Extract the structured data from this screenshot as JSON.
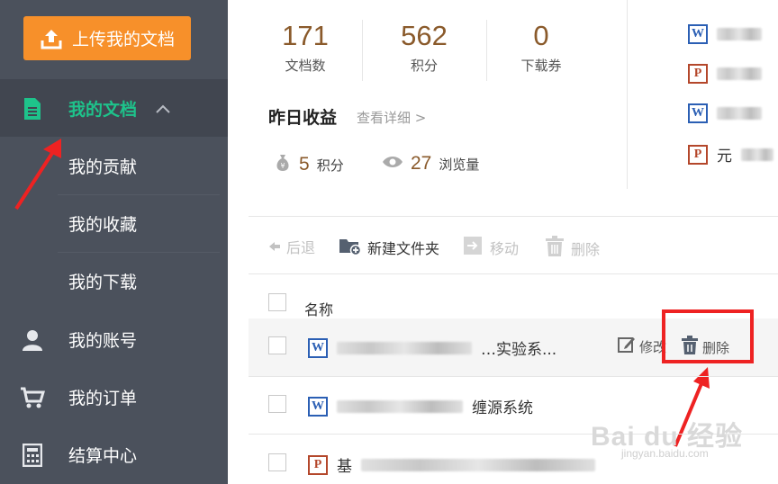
{
  "sidebar": {
    "upload_label": "上传我的文档",
    "items": [
      {
        "label": "我的文档",
        "icon": "document-icon",
        "active": true
      },
      {
        "label": "我的贡献"
      },
      {
        "label": "我的收藏"
      },
      {
        "label": "我的下载"
      },
      {
        "label": "我的账号",
        "icon": "user-icon"
      },
      {
        "label": "我的订单",
        "icon": "cart-icon"
      },
      {
        "label": "结算中心",
        "icon": "calculator-icon"
      }
    ]
  },
  "stats": [
    {
      "value": "171",
      "label": "文档数"
    },
    {
      "value": "562",
      "label": "积分"
    },
    {
      "value": "0",
      "label": "下载券"
    }
  ],
  "yesterday": {
    "title": "昨日收益",
    "detail_link": "查看详细 >",
    "points_value": "5",
    "points_label": "积分",
    "views_value": "27",
    "views_label": "浏览量"
  },
  "recent_docs": [
    {
      "type": "W",
      "text": ""
    },
    {
      "type": "P",
      "text": ""
    },
    {
      "type": "W",
      "text": ""
    },
    {
      "type": "P",
      "text": "元"
    }
  ],
  "toolbar": {
    "back": "后退",
    "new_folder": "新建文件夹",
    "move": "移动",
    "delete": "删除"
  },
  "table": {
    "header_name": "名称",
    "rows": [
      {
        "type": "W",
        "name": "…实验系..."
      },
      {
        "type": "W",
        "name": "缠源系统"
      },
      {
        "type": "P",
        "name": "基"
      }
    ],
    "row_edit_label": "修改",
    "row_delete_label": "删除"
  },
  "watermark": {
    "main": "Bai du 经验",
    "sub": "jingyan.baidu.com"
  },
  "colors": {
    "sidebar_bg": "#4b515c",
    "accent_green": "#1ec38b",
    "upload_orange": "#f7902a",
    "stat_brown": "#8a5a2b",
    "highlight_red": "#ee2222"
  }
}
